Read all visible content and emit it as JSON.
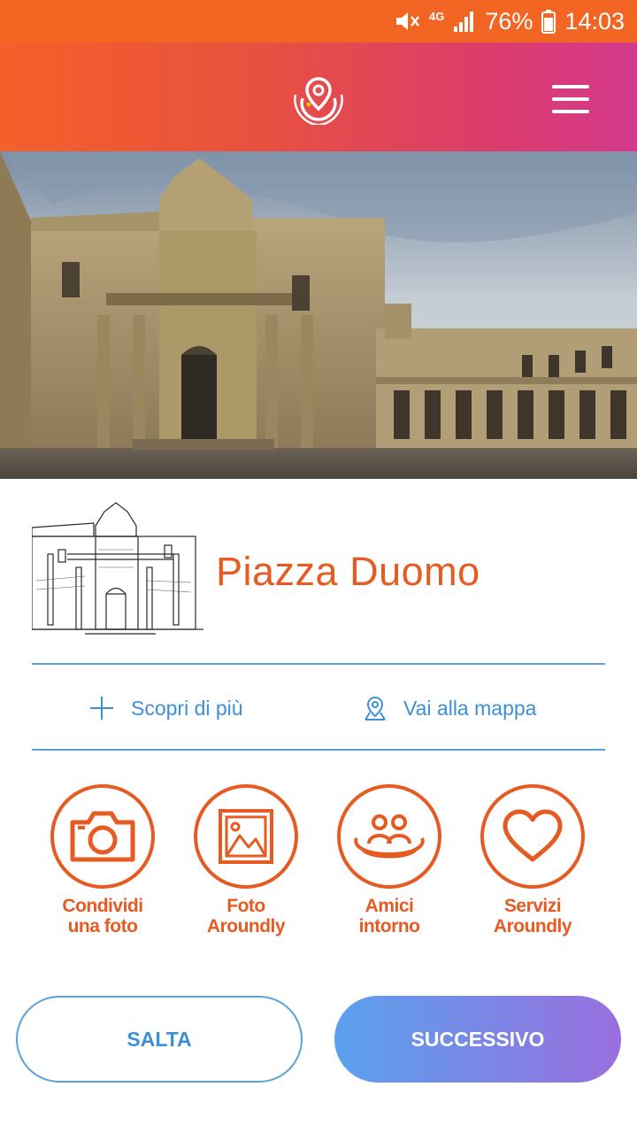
{
  "status_bar": {
    "battery": "76%",
    "time": "14:03",
    "network": "4G",
    "icons": [
      "mute-icon",
      "network-4g-icon",
      "signal-icon",
      "battery-icon"
    ]
  },
  "header": {
    "logo": "aroundly-logo",
    "menu_icon": "hamburger-menu-icon"
  },
  "colors": {
    "accent_orange": "#e55b22",
    "accent_blue": "#3d8fd6",
    "header_gradient_start": "#f4602a",
    "header_gradient_end": "#d43a8c"
  },
  "place": {
    "title": "Piazza Duomo"
  },
  "links": {
    "discover": "Scopri di più",
    "map": "Vai alla mappa"
  },
  "actions": [
    {
      "line1": "Condividi",
      "line2": "una foto",
      "icon": "camera-icon"
    },
    {
      "line1": "Foto",
      "line2": "Aroundly",
      "icon": "image-icon"
    },
    {
      "line1": "Amici",
      "line2": "intorno",
      "icon": "friends-icon"
    },
    {
      "line1": "Servizi",
      "line2": "Aroundly",
      "icon": "heart-icon"
    }
  ],
  "buttons": {
    "skip": "SALTA",
    "next": "SUCCESSIVO"
  }
}
